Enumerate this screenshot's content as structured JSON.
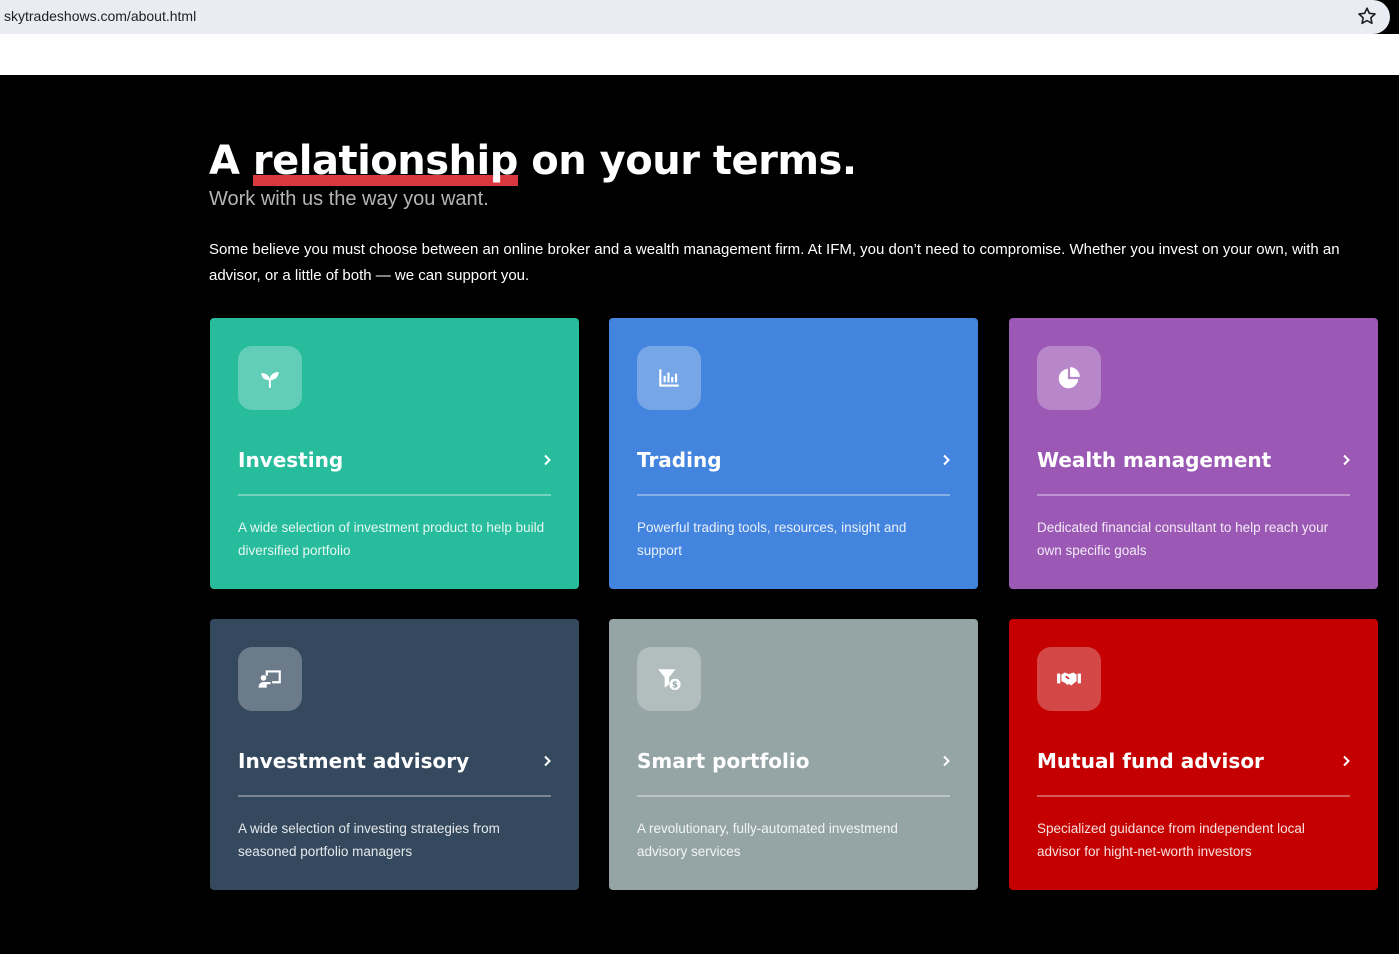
{
  "browser": {
    "url": "skytradeshows.com/about.html",
    "bookmark_icon": "star-icon"
  },
  "hero": {
    "title_before": "A ",
    "title_highlight": "relationship",
    "title_after": " on your terms.",
    "highlight_color": "#d9393e",
    "subtitle": "Work with us the way you want.",
    "intro": "Some believe you must choose between an online broker and a wealth management firm. At IFM, you don’t need to compromise. Whether you invest on your own, with an advisor, or a little of both — we can support you."
  },
  "cards": [
    {
      "title": "Investing",
      "description": "A wide selection of investment product to help build diversified portfolio",
      "icon": "sprout-icon",
      "color": "#26bc9c"
    },
    {
      "title": "Trading",
      "description": "Powerful trading tools, resources, insight and support",
      "icon": "bar-chart-icon",
      "color": "#4384de"
    },
    {
      "title": "Wealth management",
      "description": "Dedicated financial consultant to help reach your own specific goals",
      "icon": "pie-chart-icon",
      "color": "#9b59b5"
    },
    {
      "title": "Investment advisory",
      "description": "A wide selection of investing strategies from seasoned portfolio managers",
      "icon": "teacher-board-icon",
      "color": "#34495e"
    },
    {
      "title": "Smart portfolio",
      "description": "A revolutionary, fully-automated investmend advisory services",
      "icon": "funnel-dollar-icon",
      "color": "#95a5a6"
    },
    {
      "title": "Mutual fund advisor",
      "description": "Specialized guidance from independent local advisor for hight-net-worth investors",
      "icon": "handshake-icon",
      "color": "#c40000"
    }
  ]
}
